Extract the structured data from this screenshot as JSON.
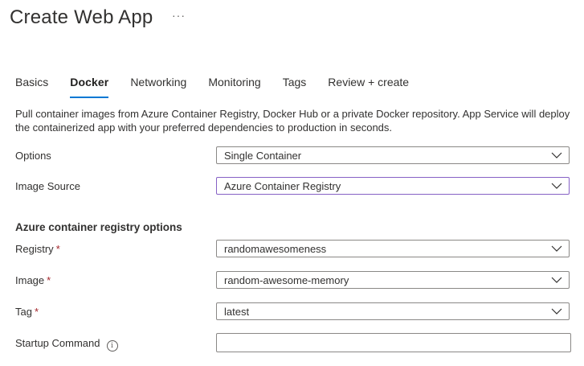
{
  "header": {
    "title": "Create Web App",
    "more_label": "···"
  },
  "tabs": [
    {
      "label": "Basics",
      "active": false
    },
    {
      "label": "Docker",
      "active": true
    },
    {
      "label": "Networking",
      "active": false
    },
    {
      "label": "Monitoring",
      "active": false
    },
    {
      "label": "Tags",
      "active": false
    },
    {
      "label": "Review + create",
      "active": false
    }
  ],
  "description": "Pull container images from Azure Container Registry, Docker Hub or a private Docker repository. App Service will deploy the containerized app with your preferred dependencies to production in seconds.",
  "options": {
    "label": "Options",
    "value": "Single Container"
  },
  "image_source": {
    "label": "Image Source",
    "value": "Azure Container Registry"
  },
  "registry_section": {
    "title": "Azure container registry options",
    "registry": {
      "label": "Registry",
      "required": "*",
      "value": "randomawesomeness"
    },
    "image": {
      "label": "Image",
      "required": "*",
      "value": "random-awesome-memory"
    },
    "tag": {
      "label": "Tag",
      "required": "*",
      "value": "latest"
    },
    "startup_command": {
      "label": "Startup Command",
      "info_icon": "i",
      "value": ""
    }
  },
  "colors": {
    "active_tab_underline": "#0078d4",
    "required_asterisk": "#a4262c",
    "focused_border": "#8661c5"
  }
}
